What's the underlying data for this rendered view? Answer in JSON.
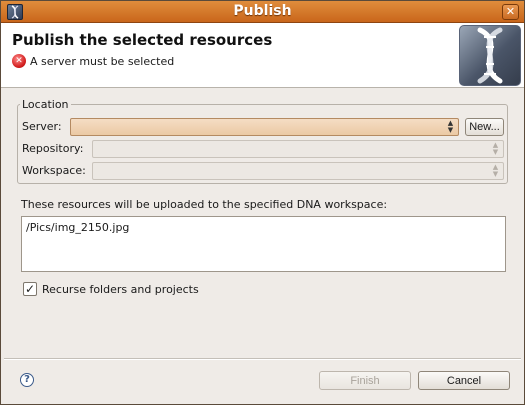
{
  "window": {
    "title": "Publish"
  },
  "header": {
    "title": "Publish the selected resources",
    "error_message": "A server must be selected",
    "image_icon": "dna-helix-icon"
  },
  "location": {
    "group_label": "Location",
    "server_label": "Server:",
    "server_value": "",
    "new_button_label": "New...",
    "repository_label": "Repository:",
    "repository_value": "",
    "workspace_label": "Workspace:",
    "workspace_value": ""
  },
  "resources": {
    "label": "These resources will be uploaded to the specified DNA workspace:",
    "items": [
      "/Pics/img_2150.jpg"
    ]
  },
  "recurse": {
    "checked": true,
    "label": "Recurse folders and projects"
  },
  "footer": {
    "help_icon": "help-icon",
    "finish_label": "Finish",
    "finish_enabled": false,
    "cancel_label": "Cancel"
  },
  "colors": {
    "titlebar": "#d97a2f",
    "error": "#d21e1e",
    "server_combo": "#f0d4b6"
  }
}
